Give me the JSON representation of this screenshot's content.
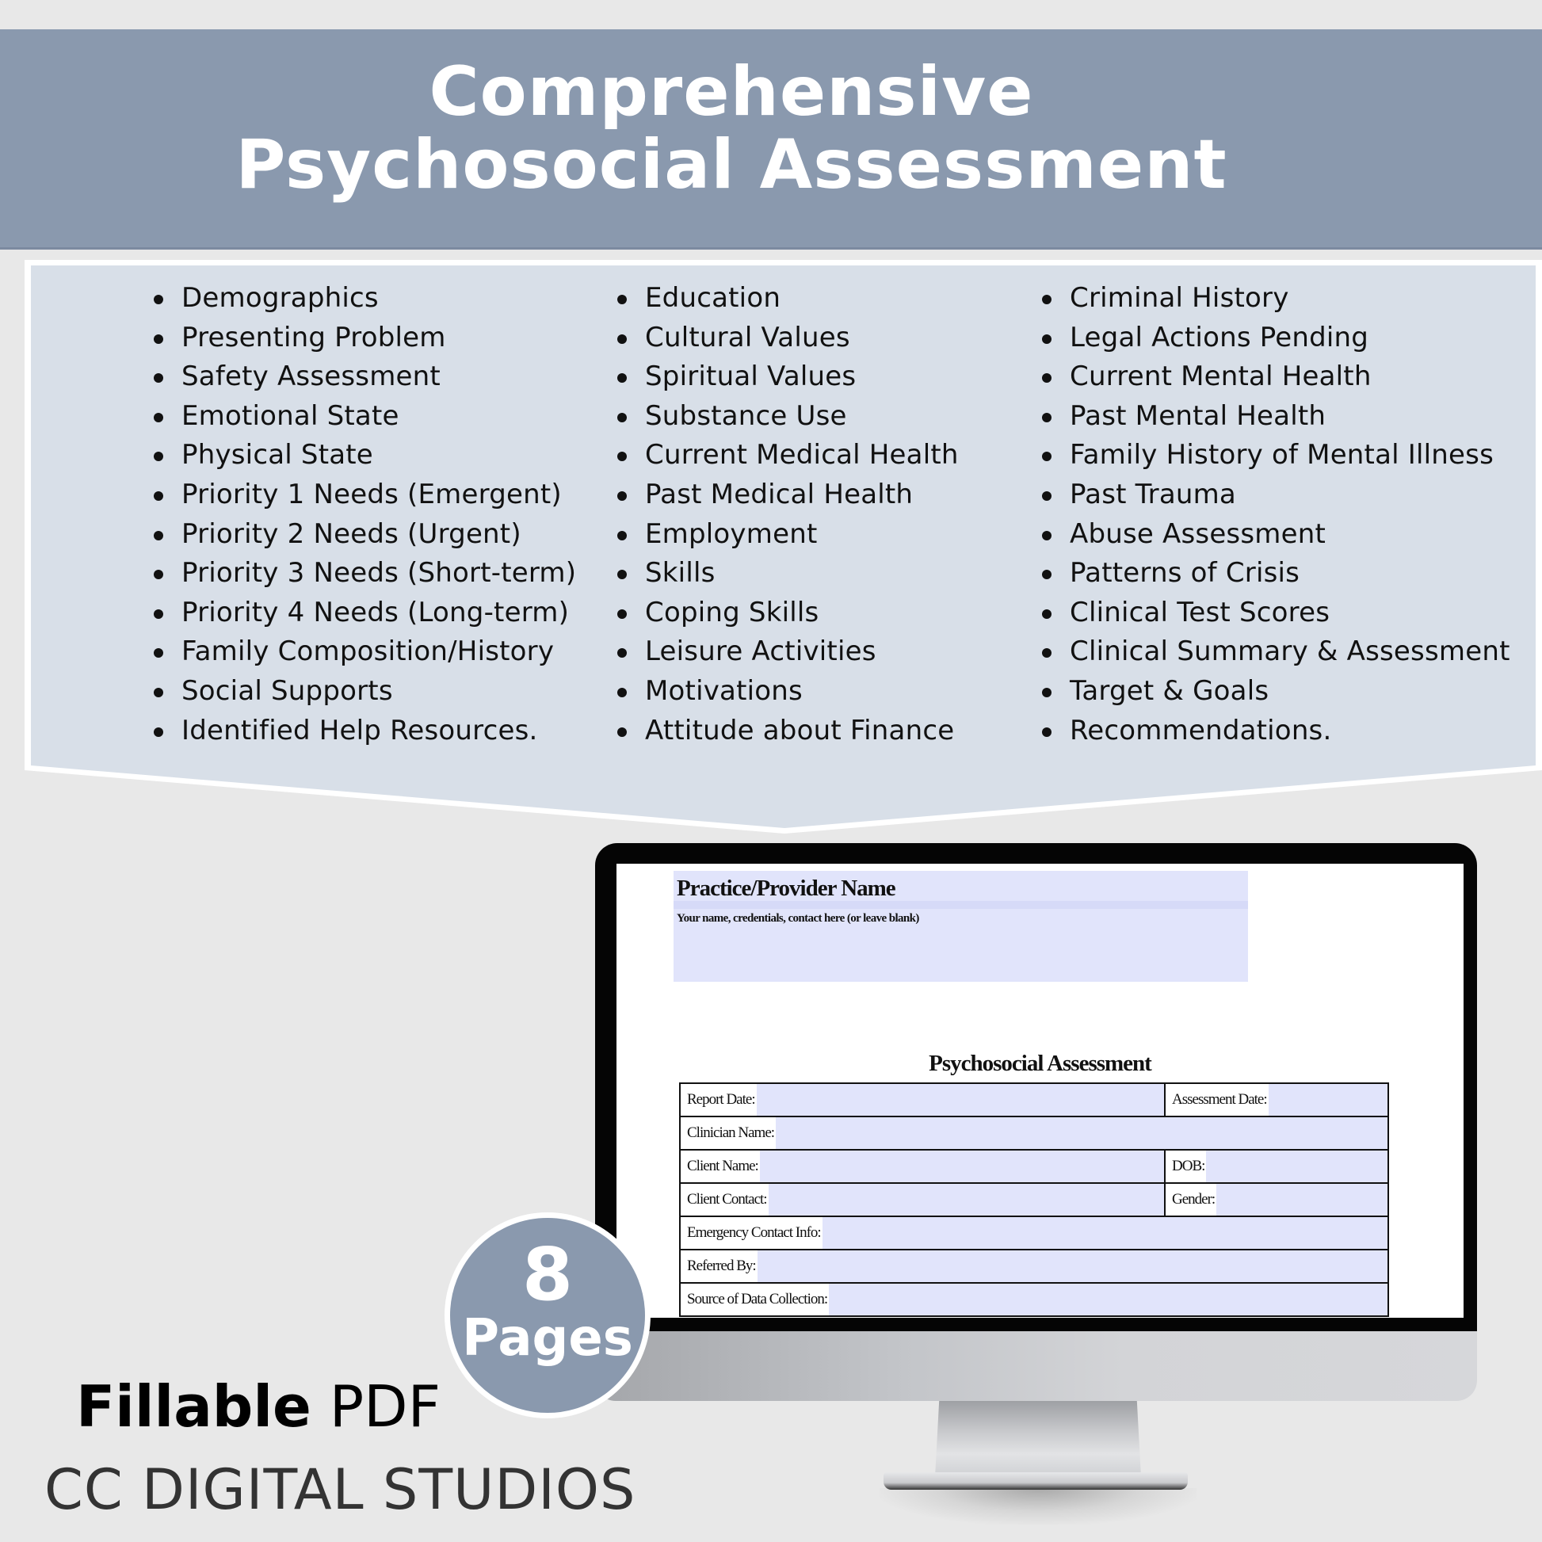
{
  "header": {
    "title_line1": "Comprehensive",
    "title_line2": "Psychosocial Assessment"
  },
  "topics": {
    "column1": [
      "Demographics",
      "Presenting Problem",
      "Safety Assessment",
      "Emotional State",
      "Physical State",
      "Priority 1 Needs (Emergent)",
      "Priority 2 Needs (Urgent)",
      "Priority 3 Needs (Short-term)",
      "Priority 4 Needs (Long-term)",
      "Family Composition/History",
      "Social Supports",
      "Identified Help Resources."
    ],
    "column2": [
      "Education",
      "Cultural Values",
      "Spiritual Values",
      "Substance Use",
      "Current Medical Health",
      "Past Medical Health",
      "Employment",
      "Skills",
      "Coping Skills",
      "Leisure Activities",
      "Motivations",
      "Attitude about Finance"
    ],
    "column3": [
      "Criminal History",
      "Legal Actions Pending",
      "Current Mental Health",
      "Past Mental Health",
      "Family History of Mental Illness",
      "Past Trauma",
      "Abuse Assessment",
      "Patterns of Crisis",
      "Clinical Test Scores",
      "Clinical Summary & Assessment",
      "Target & Goals",
      "Recommendations."
    ]
  },
  "pdf_preview": {
    "provider_name": "Practice/Provider Name",
    "provider_subtitle": "Your name, credentials, contact here (or leave blank)",
    "form_title": "Psychosocial Assessment",
    "fields": {
      "report_date": {
        "label": "Report Date:",
        "value": ""
      },
      "assessment_date": {
        "label": "Assessment Date:",
        "value": ""
      },
      "clinician_name": {
        "label": "Clinician Name:",
        "value": ""
      },
      "client_name": {
        "label": "Client Name:",
        "value": ""
      },
      "dob": {
        "label": "DOB:",
        "value": ""
      },
      "client_contact": {
        "label": "Client Contact:",
        "value": ""
      },
      "gender": {
        "label": "Gender:",
        "value": ""
      },
      "emergency_contact": {
        "label": "Emergency Contact Info:",
        "value": ""
      },
      "referred_by": {
        "label": "Referred By:",
        "value": ""
      },
      "source_of_data": {
        "label": "Source of Data Collection:",
        "value": ""
      }
    }
  },
  "badge": {
    "number": "8",
    "label": "Pages"
  },
  "footer": {
    "format_bold": "Fillable",
    "format_rest": " PDF",
    "brand": "CC DIGITAL STUDIOS"
  },
  "colors": {
    "header_band": "#8a99ae",
    "panel_fill": "#d8dfe8",
    "background": "#e8e8e8",
    "form_field": "#e1e4fb"
  }
}
